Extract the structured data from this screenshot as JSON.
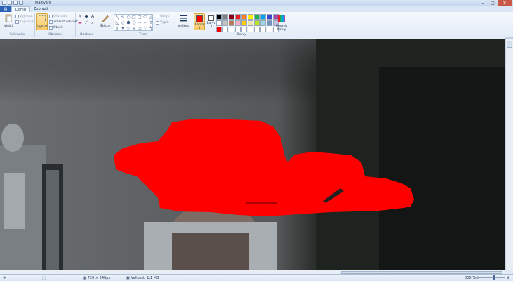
{
  "window": {
    "title": "Malování"
  },
  "tabs": [
    {
      "label": "▤"
    },
    {
      "label": "Domů"
    },
    {
      "label": "Zobrazit"
    }
  ],
  "clipboard": {
    "paste": "Vložit",
    "cut": "Vyjmout",
    "copy": "Kopírovat",
    "group": "Schránka"
  },
  "image": {
    "select": "Vybrat",
    "crop": "Oříznout",
    "resize": "Změnit velikost",
    "rotate": "Otočit",
    "group": "Obrázek"
  },
  "tools": {
    "group": "Nástroje"
  },
  "brushes": {
    "label": "Štětce"
  },
  "shapes": {
    "outline": "Obrys",
    "fill": "Výplň",
    "group": "Tvary"
  },
  "size": {
    "label": "Velikost"
  },
  "colors": {
    "color1": "Barva 1",
    "color2": "Barva 2",
    "edit": "Upravit barvy",
    "group": "Barvy",
    "color1_value": "#ff0000",
    "color2_value": "#ffffff",
    "palette_row1": [
      "#000000",
      "#7f7f7f",
      "#880015",
      "#ed1c24",
      "#ff7f27",
      "#fff200",
      "#22b14c",
      "#00a2e8",
      "#3f48cc",
      "#a349a4"
    ],
    "palette_row2": [
      "#ffffff",
      "#c3c3c3",
      "#b97a57",
      "#ffaec9",
      "#ffc90e",
      "#efe4b0",
      "#b5e61d",
      "#99d9ea",
      "#7092be",
      "#c8bfe7"
    ],
    "palette_row3": [
      "#ff0000",
      "#ffffff",
      "#ffffff",
      "#ffffff",
      "#ffffff",
      "#ffffff",
      "#ffffff",
      "#ffffff",
      "#ffffff",
      "#ffffff"
    ]
  },
  "status": {
    "dimensions": "720 × 540px",
    "filesize": "Velikost: 1,1 MB",
    "zoom": "800 %"
  }
}
